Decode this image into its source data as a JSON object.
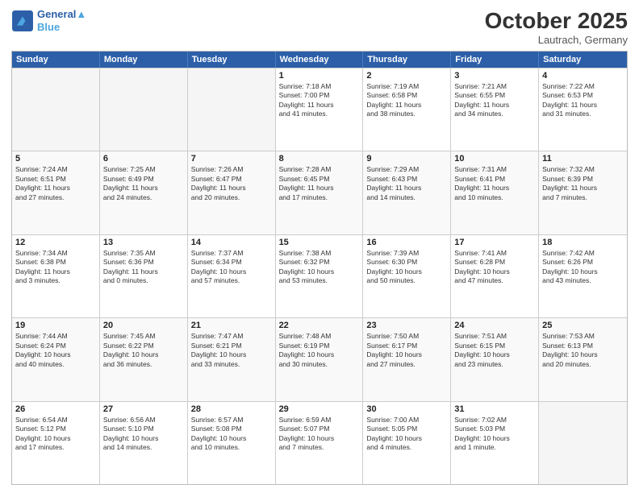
{
  "header": {
    "logo_line1": "General",
    "logo_line2": "Blue",
    "month": "October 2025",
    "location": "Lautrach, Germany"
  },
  "weekdays": [
    "Sunday",
    "Monday",
    "Tuesday",
    "Wednesday",
    "Thursday",
    "Friday",
    "Saturday"
  ],
  "rows": [
    [
      {
        "day": "",
        "text": "",
        "empty": true
      },
      {
        "day": "",
        "text": "",
        "empty": true
      },
      {
        "day": "",
        "text": "",
        "empty": true
      },
      {
        "day": "1",
        "text": "Sunrise: 7:18 AM\nSunset: 7:00 PM\nDaylight: 11 hours\nand 41 minutes."
      },
      {
        "day": "2",
        "text": "Sunrise: 7:19 AM\nSunset: 6:58 PM\nDaylight: 11 hours\nand 38 minutes."
      },
      {
        "day": "3",
        "text": "Sunrise: 7:21 AM\nSunset: 6:55 PM\nDaylight: 11 hours\nand 34 minutes."
      },
      {
        "day": "4",
        "text": "Sunrise: 7:22 AM\nSunset: 6:53 PM\nDaylight: 11 hours\nand 31 minutes."
      }
    ],
    [
      {
        "day": "5",
        "text": "Sunrise: 7:24 AM\nSunset: 6:51 PM\nDaylight: 11 hours\nand 27 minutes."
      },
      {
        "day": "6",
        "text": "Sunrise: 7:25 AM\nSunset: 6:49 PM\nDaylight: 11 hours\nand 24 minutes."
      },
      {
        "day": "7",
        "text": "Sunrise: 7:26 AM\nSunset: 6:47 PM\nDaylight: 11 hours\nand 20 minutes."
      },
      {
        "day": "8",
        "text": "Sunrise: 7:28 AM\nSunset: 6:45 PM\nDaylight: 11 hours\nand 17 minutes."
      },
      {
        "day": "9",
        "text": "Sunrise: 7:29 AM\nSunset: 6:43 PM\nDaylight: 11 hours\nand 14 minutes."
      },
      {
        "day": "10",
        "text": "Sunrise: 7:31 AM\nSunset: 6:41 PM\nDaylight: 11 hours\nand 10 minutes."
      },
      {
        "day": "11",
        "text": "Sunrise: 7:32 AM\nSunset: 6:39 PM\nDaylight: 11 hours\nand 7 minutes."
      }
    ],
    [
      {
        "day": "12",
        "text": "Sunrise: 7:34 AM\nSunset: 6:38 PM\nDaylight: 11 hours\nand 3 minutes."
      },
      {
        "day": "13",
        "text": "Sunrise: 7:35 AM\nSunset: 6:36 PM\nDaylight: 11 hours\nand 0 minutes."
      },
      {
        "day": "14",
        "text": "Sunrise: 7:37 AM\nSunset: 6:34 PM\nDaylight: 10 hours\nand 57 minutes."
      },
      {
        "day": "15",
        "text": "Sunrise: 7:38 AM\nSunset: 6:32 PM\nDaylight: 10 hours\nand 53 minutes."
      },
      {
        "day": "16",
        "text": "Sunrise: 7:39 AM\nSunset: 6:30 PM\nDaylight: 10 hours\nand 50 minutes."
      },
      {
        "day": "17",
        "text": "Sunrise: 7:41 AM\nSunset: 6:28 PM\nDaylight: 10 hours\nand 47 minutes."
      },
      {
        "day": "18",
        "text": "Sunrise: 7:42 AM\nSunset: 6:26 PM\nDaylight: 10 hours\nand 43 minutes."
      }
    ],
    [
      {
        "day": "19",
        "text": "Sunrise: 7:44 AM\nSunset: 6:24 PM\nDaylight: 10 hours\nand 40 minutes."
      },
      {
        "day": "20",
        "text": "Sunrise: 7:45 AM\nSunset: 6:22 PM\nDaylight: 10 hours\nand 36 minutes."
      },
      {
        "day": "21",
        "text": "Sunrise: 7:47 AM\nSunset: 6:21 PM\nDaylight: 10 hours\nand 33 minutes."
      },
      {
        "day": "22",
        "text": "Sunrise: 7:48 AM\nSunset: 6:19 PM\nDaylight: 10 hours\nand 30 minutes."
      },
      {
        "day": "23",
        "text": "Sunrise: 7:50 AM\nSunset: 6:17 PM\nDaylight: 10 hours\nand 27 minutes."
      },
      {
        "day": "24",
        "text": "Sunrise: 7:51 AM\nSunset: 6:15 PM\nDaylight: 10 hours\nand 23 minutes."
      },
      {
        "day": "25",
        "text": "Sunrise: 7:53 AM\nSunset: 6:13 PM\nDaylight: 10 hours\nand 20 minutes."
      }
    ],
    [
      {
        "day": "26",
        "text": "Sunrise: 6:54 AM\nSunset: 5:12 PM\nDaylight: 10 hours\nand 17 minutes."
      },
      {
        "day": "27",
        "text": "Sunrise: 6:56 AM\nSunset: 5:10 PM\nDaylight: 10 hours\nand 14 minutes."
      },
      {
        "day": "28",
        "text": "Sunrise: 6:57 AM\nSunset: 5:08 PM\nDaylight: 10 hours\nand 10 minutes."
      },
      {
        "day": "29",
        "text": "Sunrise: 6:59 AM\nSunset: 5:07 PM\nDaylight: 10 hours\nand 7 minutes."
      },
      {
        "day": "30",
        "text": "Sunrise: 7:00 AM\nSunset: 5:05 PM\nDaylight: 10 hours\nand 4 minutes."
      },
      {
        "day": "31",
        "text": "Sunrise: 7:02 AM\nSunset: 5:03 PM\nDaylight: 10 hours\nand 1 minute."
      },
      {
        "day": "",
        "text": "",
        "empty": true
      }
    ]
  ]
}
